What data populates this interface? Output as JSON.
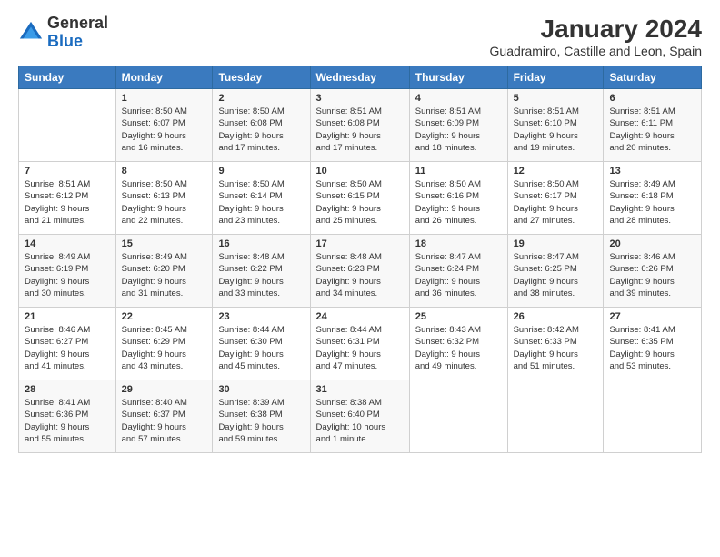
{
  "logo": {
    "general": "General",
    "blue": "Blue"
  },
  "title": "January 2024",
  "subtitle": "Guadramiro, Castille and Leon, Spain",
  "days_of_week": [
    "Sunday",
    "Monday",
    "Tuesday",
    "Wednesday",
    "Thursday",
    "Friday",
    "Saturday"
  ],
  "weeks": [
    [
      {
        "num": "",
        "content": ""
      },
      {
        "num": "1",
        "content": "Sunrise: 8:50 AM\nSunset: 6:07 PM\nDaylight: 9 hours\nand 16 minutes."
      },
      {
        "num": "2",
        "content": "Sunrise: 8:50 AM\nSunset: 6:08 PM\nDaylight: 9 hours\nand 17 minutes."
      },
      {
        "num": "3",
        "content": "Sunrise: 8:51 AM\nSunset: 6:08 PM\nDaylight: 9 hours\nand 17 minutes."
      },
      {
        "num": "4",
        "content": "Sunrise: 8:51 AM\nSunset: 6:09 PM\nDaylight: 9 hours\nand 18 minutes."
      },
      {
        "num": "5",
        "content": "Sunrise: 8:51 AM\nSunset: 6:10 PM\nDaylight: 9 hours\nand 19 minutes."
      },
      {
        "num": "6",
        "content": "Sunrise: 8:51 AM\nSunset: 6:11 PM\nDaylight: 9 hours\nand 20 minutes."
      }
    ],
    [
      {
        "num": "7",
        "content": "Sunrise: 8:51 AM\nSunset: 6:12 PM\nDaylight: 9 hours\nand 21 minutes."
      },
      {
        "num": "8",
        "content": "Sunrise: 8:50 AM\nSunset: 6:13 PM\nDaylight: 9 hours\nand 22 minutes."
      },
      {
        "num": "9",
        "content": "Sunrise: 8:50 AM\nSunset: 6:14 PM\nDaylight: 9 hours\nand 23 minutes."
      },
      {
        "num": "10",
        "content": "Sunrise: 8:50 AM\nSunset: 6:15 PM\nDaylight: 9 hours\nand 25 minutes."
      },
      {
        "num": "11",
        "content": "Sunrise: 8:50 AM\nSunset: 6:16 PM\nDaylight: 9 hours\nand 26 minutes."
      },
      {
        "num": "12",
        "content": "Sunrise: 8:50 AM\nSunset: 6:17 PM\nDaylight: 9 hours\nand 27 minutes."
      },
      {
        "num": "13",
        "content": "Sunrise: 8:49 AM\nSunset: 6:18 PM\nDaylight: 9 hours\nand 28 minutes."
      }
    ],
    [
      {
        "num": "14",
        "content": "Sunrise: 8:49 AM\nSunset: 6:19 PM\nDaylight: 9 hours\nand 30 minutes."
      },
      {
        "num": "15",
        "content": "Sunrise: 8:49 AM\nSunset: 6:20 PM\nDaylight: 9 hours\nand 31 minutes."
      },
      {
        "num": "16",
        "content": "Sunrise: 8:48 AM\nSunset: 6:22 PM\nDaylight: 9 hours\nand 33 minutes."
      },
      {
        "num": "17",
        "content": "Sunrise: 8:48 AM\nSunset: 6:23 PM\nDaylight: 9 hours\nand 34 minutes."
      },
      {
        "num": "18",
        "content": "Sunrise: 8:47 AM\nSunset: 6:24 PM\nDaylight: 9 hours\nand 36 minutes."
      },
      {
        "num": "19",
        "content": "Sunrise: 8:47 AM\nSunset: 6:25 PM\nDaylight: 9 hours\nand 38 minutes."
      },
      {
        "num": "20",
        "content": "Sunrise: 8:46 AM\nSunset: 6:26 PM\nDaylight: 9 hours\nand 39 minutes."
      }
    ],
    [
      {
        "num": "21",
        "content": "Sunrise: 8:46 AM\nSunset: 6:27 PM\nDaylight: 9 hours\nand 41 minutes."
      },
      {
        "num": "22",
        "content": "Sunrise: 8:45 AM\nSunset: 6:29 PM\nDaylight: 9 hours\nand 43 minutes."
      },
      {
        "num": "23",
        "content": "Sunrise: 8:44 AM\nSunset: 6:30 PM\nDaylight: 9 hours\nand 45 minutes."
      },
      {
        "num": "24",
        "content": "Sunrise: 8:44 AM\nSunset: 6:31 PM\nDaylight: 9 hours\nand 47 minutes."
      },
      {
        "num": "25",
        "content": "Sunrise: 8:43 AM\nSunset: 6:32 PM\nDaylight: 9 hours\nand 49 minutes."
      },
      {
        "num": "26",
        "content": "Sunrise: 8:42 AM\nSunset: 6:33 PM\nDaylight: 9 hours\nand 51 minutes."
      },
      {
        "num": "27",
        "content": "Sunrise: 8:41 AM\nSunset: 6:35 PM\nDaylight: 9 hours\nand 53 minutes."
      }
    ],
    [
      {
        "num": "28",
        "content": "Sunrise: 8:41 AM\nSunset: 6:36 PM\nDaylight: 9 hours\nand 55 minutes."
      },
      {
        "num": "29",
        "content": "Sunrise: 8:40 AM\nSunset: 6:37 PM\nDaylight: 9 hours\nand 57 minutes."
      },
      {
        "num": "30",
        "content": "Sunrise: 8:39 AM\nSunset: 6:38 PM\nDaylight: 9 hours\nand 59 minutes."
      },
      {
        "num": "31",
        "content": "Sunrise: 8:38 AM\nSunset: 6:40 PM\nDaylight: 10 hours\nand 1 minute."
      },
      {
        "num": "",
        "content": ""
      },
      {
        "num": "",
        "content": ""
      },
      {
        "num": "",
        "content": ""
      }
    ]
  ]
}
